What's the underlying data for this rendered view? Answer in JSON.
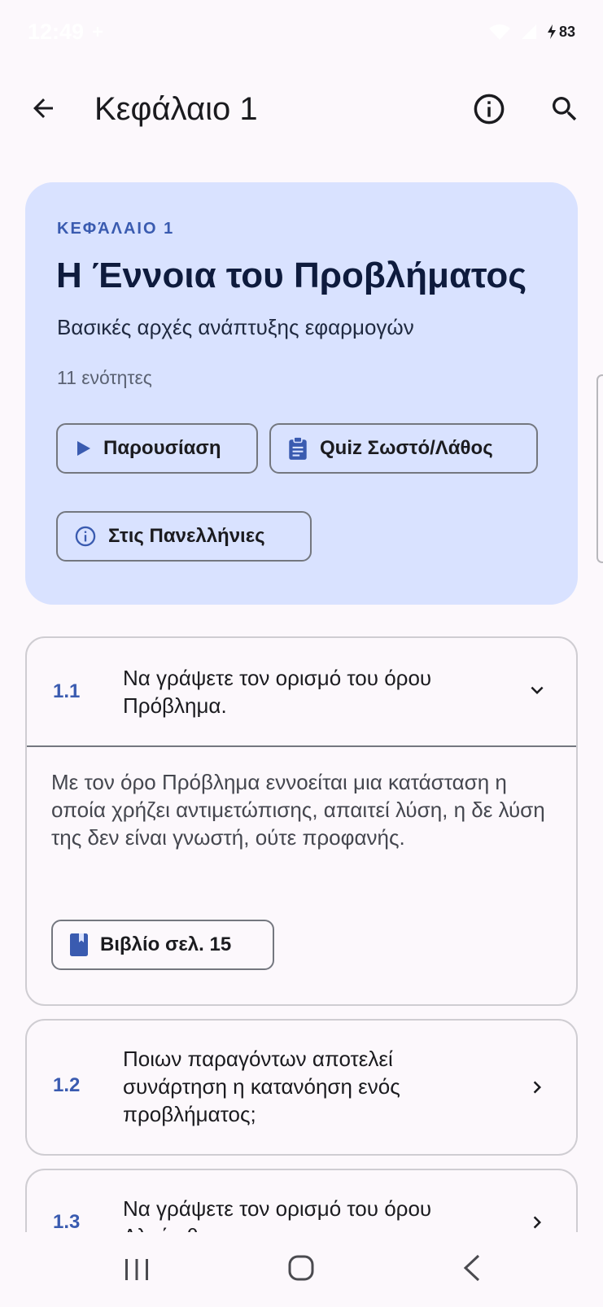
{
  "status_bar": {
    "time": "12:49",
    "battery": "83"
  },
  "app_bar": {
    "title": "Κεφάλαιο 1",
    "back_icon": "arrow-left-icon",
    "info_icon": "info-outline-icon",
    "search_icon": "search-icon"
  },
  "chapter": {
    "overline": "ΚΕΦΆΛΑΙΟ 1",
    "title": "Η Έννοια του Προβλήματος",
    "subtitle": "Βασικές αρχές ανάπτυξης εφαρμογών",
    "count": "11 ενότητες",
    "buttons": {
      "presentation": "Παρουσίαση",
      "quiz": "Quiz Σωστό/Λάθος",
      "exams": "Στις Πανελλήνιες"
    }
  },
  "questions": [
    {
      "number": "1.1",
      "text": "Να γράψετε τον ορισμό του όρου Πρόβλημα.",
      "expanded": true,
      "answer": "Με τον όρο Πρόβλημα εννοείται μια κατάσταση η οποία χρήζει αντιμετώπισης, απαιτεί λύση, η δε λύση της δεν είναι γνωστή, ούτε προφανής.",
      "book_ref": "Βιβλίο σελ. 15"
    },
    {
      "number": "1.2",
      "text": "Ποιων παραγόντων αποτελεί συνάρτηση η κατανόηση ενός προβλήματος;",
      "expanded": false
    },
    {
      "number": "1.3",
      "text": "Να γράψετε τον ορισμό του όρου Αλγόριθμος.",
      "expanded": false
    }
  ],
  "colors": {
    "accent": "#3a5bb0",
    "card_bg": "#d9e2ff",
    "page_bg": "#fcf8fc"
  }
}
